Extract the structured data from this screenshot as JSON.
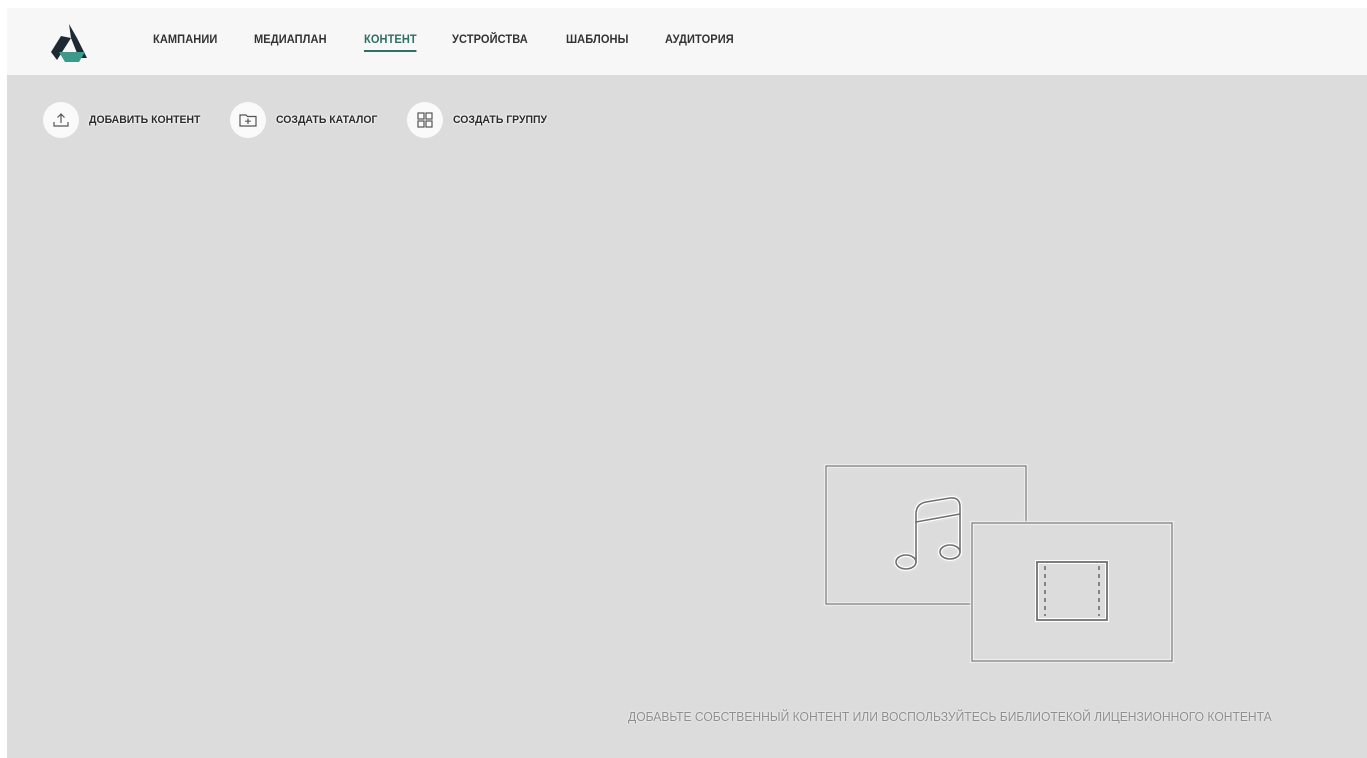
{
  "colors": {
    "accent": "#2f6f66",
    "header_bg": "#f7f7f7",
    "content_bg": "#dcdcdc",
    "logo_dark": "#1d2a33",
    "logo_teal": "#3d9a8b"
  },
  "logo": {
    "icon": "triangle-logo"
  },
  "nav": {
    "items": [
      {
        "label": "КАМПАНИИ",
        "active": false
      },
      {
        "label": "МЕДИАПЛАН",
        "active": false
      },
      {
        "label": "КОНТЕНТ",
        "active": true
      },
      {
        "label": "УСТРОЙСТВА",
        "active": false
      },
      {
        "label": "ШАБЛОНЫ",
        "active": false
      },
      {
        "label": "АУДИТОРИЯ",
        "active": false
      }
    ]
  },
  "actions": [
    {
      "label": "ДОБАВИТЬ КОНТЕНТ",
      "icon": "upload-icon"
    },
    {
      "label": "СОЗДАТЬ КАТАЛОГ",
      "icon": "folder-plus-icon"
    },
    {
      "label": "СОЗДАТЬ ГРУППУ",
      "icon": "grid-icon"
    }
  ],
  "empty_state": {
    "icons": [
      "music-note-icon",
      "film-icon"
    ],
    "message": "ДОБАВЬТЕ СОБСТВЕННЫЙ КОНТЕНТ ИЛИ ВОСПОЛЬЗУЙТЕСЬ БИБЛИОТЕКОЙ ЛИЦЕНЗИОННОГО КОНТЕНТА"
  }
}
